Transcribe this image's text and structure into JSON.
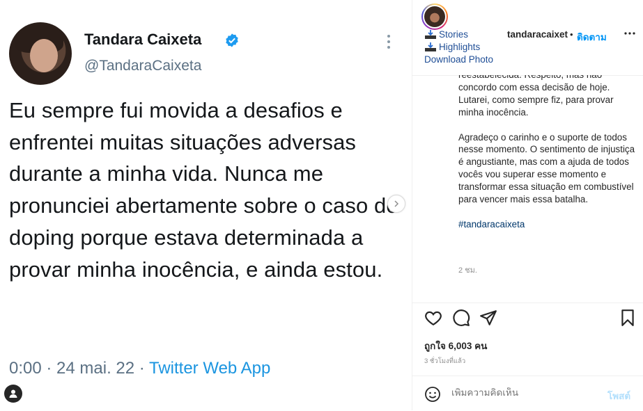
{
  "tweet": {
    "name": "Tandara Caixeta",
    "handle": "@TandaraCaixeta",
    "text": "Eu sempre fui movida a desafios e enfrentei muitas situações adversas durante a minha vida. Nunca me pronunciei abertamente sobre o caso do doping porque estava determinada a provar minha inocência, e ainda estou.",
    "meta_time": "0:00 · 24 mai. 22 · ",
    "meta_app": "Twitter Web App"
  },
  "header": {
    "links": {
      "stories": "Stories",
      "highlights": "Highlights",
      "download": "Download Photo"
    },
    "username": "tandaracaixet",
    "separator": "•",
    "follow_label": "ติดตาม"
  },
  "caption": {
    "cut_line": "reestabelecida. Respeito, mas não concordo com essa decisão de hoje. Lutarei, como sempre fiz, para provar minha inocência.",
    "paragraph2": "Agradeço o carinho e o suporte de todos nesse momento. O sentimento de injustiça é angustiante, mas com a ajuda de todos vocês vou superar esse momento e transformar essa situação em combustível para vencer mais essa batalha.",
    "hashtag": "#tandaracaixeta",
    "time_ago": "2 ชม."
  },
  "likes": {
    "label": "ถูกใจ 6,003 คน"
  },
  "post_time": "3 ชั่วโมงที่แล้ว",
  "comment": {
    "placeholder": "เพิ่มความคิดเห็น",
    "post_label": "โพสต์"
  },
  "colors": {
    "link_blue": "#0095f6",
    "twitter_blue": "#1b95e0",
    "muted": "#8e8e8e"
  }
}
